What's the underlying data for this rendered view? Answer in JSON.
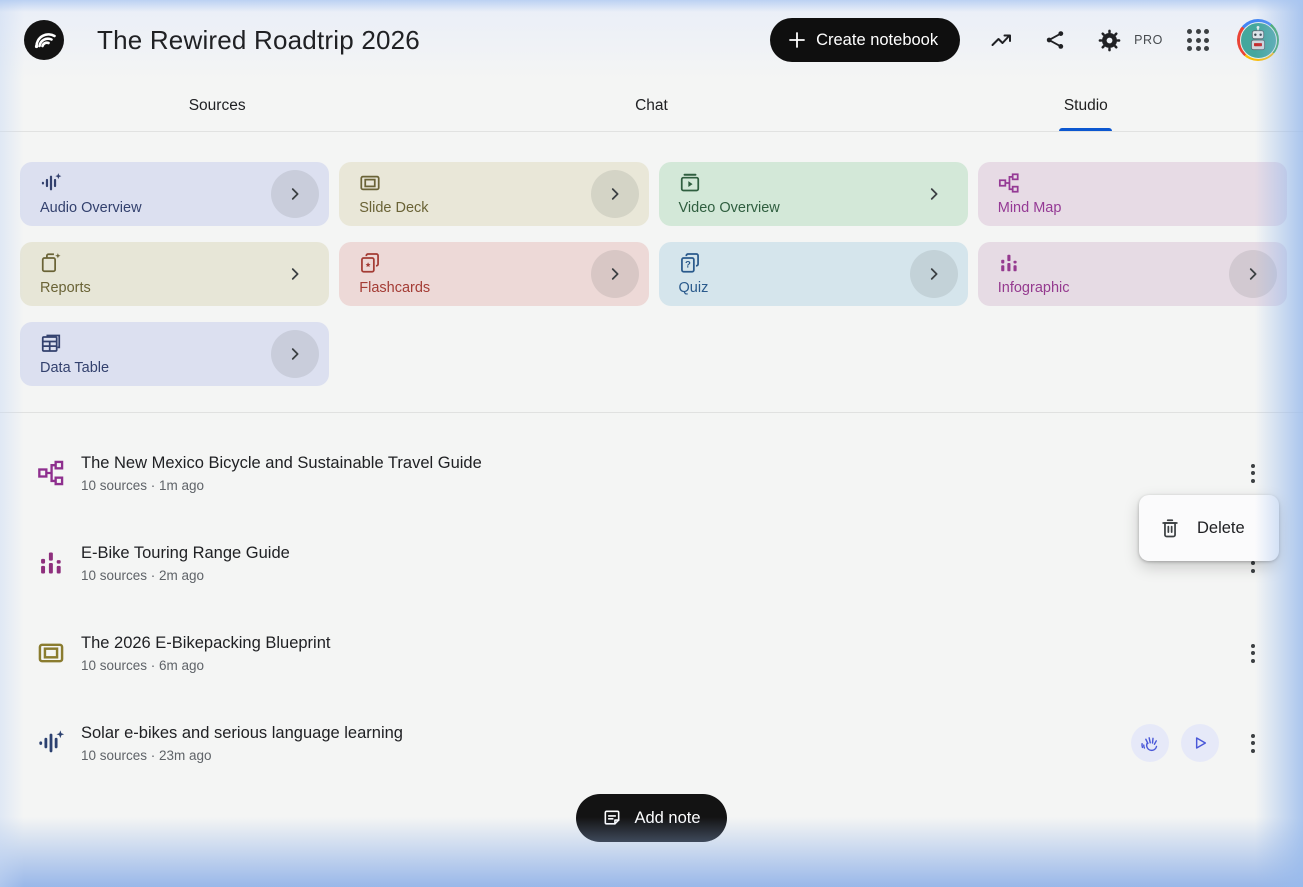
{
  "header": {
    "title": "The Rewired Roadtrip 2026",
    "create_button_label": "Create notebook",
    "pro_label": "PRO",
    "icons": [
      "notebooklm-logo",
      "trending-up-icon",
      "share-icon",
      "settings-gear-icon",
      "apps-grid-icon",
      "avatar"
    ]
  },
  "tabs": [
    {
      "label": "Sources",
      "active": false
    },
    {
      "label": "Chat",
      "active": false
    },
    {
      "label": "Studio",
      "active": true
    }
  ],
  "studio": {
    "cards": [
      {
        "label": "Audio Overview",
        "icon": "audio-waveform-icon",
        "bg": "#dce0f0",
        "fg": "#33416e",
        "chevron": "circle"
      },
      {
        "label": "Slide Deck",
        "icon": "slide-deck-icon",
        "bg": "#e9e7d8",
        "fg": "#6a6336",
        "chevron": "circle"
      },
      {
        "label": "Video Overview",
        "icon": "video-icon",
        "bg": "#d3e8d8",
        "fg": "#2f5e3f",
        "chevron": "plain"
      },
      {
        "label": "Mind Map",
        "icon": "mind-map-icon",
        "bg": "#e7dbe5",
        "fg": "#953a95",
        "chevron": "none"
      },
      {
        "label": "Reports",
        "icon": "reports-icon",
        "bg": "#e7e6d7",
        "fg": "#6a6336",
        "chevron": "plain"
      },
      {
        "label": "Flashcards",
        "icon": "flashcards-icon",
        "bg": "#edd9d7",
        "fg": "#a43c35",
        "chevron": "circle"
      },
      {
        "label": "Quiz",
        "icon": "quiz-icon",
        "bg": "#d5e5ec",
        "fg": "#2a5a8c",
        "chevron": "circle"
      },
      {
        "label": "Infographic",
        "icon": "infographic-icon",
        "bg": "#e6dbe4",
        "fg": "#953a8f",
        "chevron": "circle"
      },
      {
        "label": "Data Table",
        "icon": "data-table-icon",
        "bg": "#dce0f0",
        "fg": "#33416e",
        "chevron": "circle"
      }
    ]
  },
  "artifacts": [
    {
      "title": "The New Mexico Bicycle and Sustainable Travel Guide",
      "meta": "10 sources · 1m ago",
      "icon": "mind-map-icon",
      "icon_color": "#8e2f8e"
    },
    {
      "title": "E-Bike Touring Range Guide",
      "meta": "10 sources · 2m ago",
      "icon": "infographic-icon",
      "icon_color": "#8e2f7d"
    },
    {
      "title": "The 2026 E-Bikepacking Blueprint",
      "meta": "10 sources · 6m ago",
      "icon": "slide-deck-icon",
      "icon_color": "#8a7c2f"
    },
    {
      "title": "Solar e-bikes and serious language learning",
      "meta": "10 sources · 23m ago",
      "icon": "audio-waveform-icon",
      "icon_color": "#2c4170",
      "controls": [
        "interactive-mode-button",
        "play-button"
      ]
    }
  ],
  "context_menu": {
    "items": [
      {
        "label": "Delete",
        "icon": "trash-icon"
      }
    ]
  },
  "footer": {
    "add_note_label": "Add note"
  },
  "palette": {
    "accent_blue": "#0b57d0",
    "header_button_bg": "#0f0f0f",
    "edge_glow_blue": "#94b4e8",
    "meta_text": "#5f6368"
  }
}
